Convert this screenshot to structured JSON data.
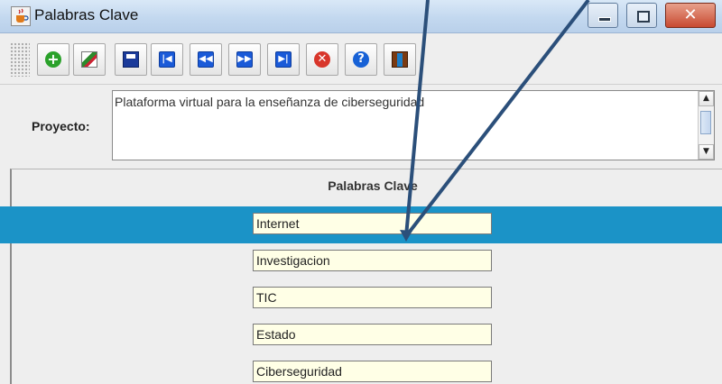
{
  "window": {
    "title": "Palabras Clave",
    "icon": "java-cup-icon",
    "controls": {
      "minimize": "minimize-icon",
      "maximize": "maximize-icon",
      "close_glyph": "✕"
    }
  },
  "toolbar": {
    "buttons": [
      {
        "name": "add",
        "icon": "add-icon",
        "glyph": "+"
      },
      {
        "name": "edit",
        "icon": "edit-icon",
        "glyph": ""
      },
      {
        "name": "save",
        "icon": "save-icon",
        "glyph": ""
      },
      {
        "name": "first",
        "icon": "first-record-icon",
        "glyph": "|◀"
      },
      {
        "name": "previous",
        "icon": "previous-record-icon",
        "glyph": "◀◀"
      },
      {
        "name": "next",
        "icon": "next-record-icon",
        "glyph": "▶▶"
      },
      {
        "name": "last",
        "icon": "last-record-icon",
        "glyph": "▶|"
      },
      {
        "name": "cancel",
        "icon": "cancel-icon",
        "glyph": "✕"
      },
      {
        "name": "help",
        "icon": "help-icon",
        "glyph": "?"
      },
      {
        "name": "exit",
        "icon": "exit-door-icon",
        "glyph": ""
      }
    ]
  },
  "proyecto": {
    "label": "Proyecto:",
    "value": "Plataforma virtual para la enseñanza de ciberseguridad",
    "scroll_up": "▲",
    "scroll_down": "▼"
  },
  "keywords": {
    "header": "Palabras Clave",
    "selected_index": 0,
    "items": [
      "Internet",
      "Investigacion",
      "TIC",
      "Estado",
      "Ciberseguridad"
    ]
  },
  "colors": {
    "selection": "#1b93c7",
    "field_background": "#ffffe6",
    "annotation_arrow": "#2b4f7a"
  }
}
